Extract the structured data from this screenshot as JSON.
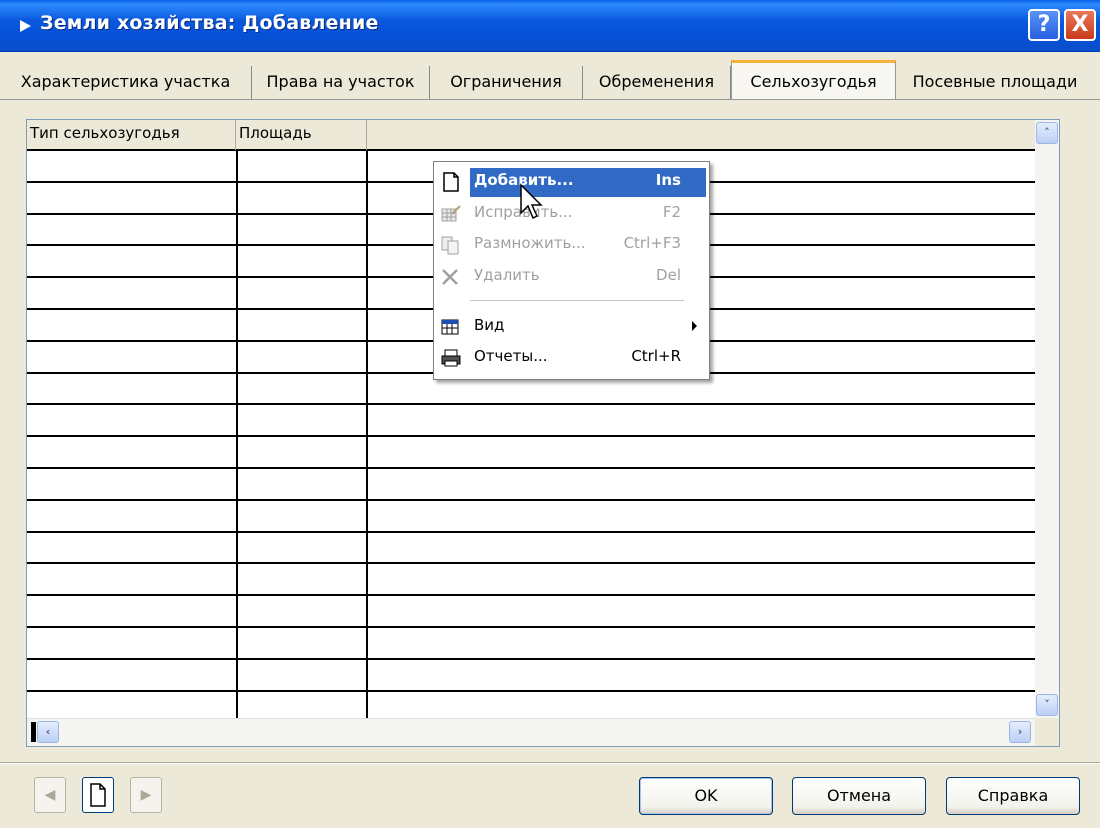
{
  "window": {
    "title": "Земли хозяйства: Добавление"
  },
  "title_buttons": {
    "help": "?",
    "close": "X"
  },
  "tabs": [
    {
      "label": "Характеристика участка",
      "active": false
    },
    {
      "label": "Права на участок",
      "active": false
    },
    {
      "label": "Ограничения",
      "active": false
    },
    {
      "label": "Обременения",
      "active": false
    },
    {
      "label": "Сельхозугодья",
      "active": true
    },
    {
      "label": "Посевные площади",
      "active": false
    }
  ],
  "table": {
    "columns": [
      "Тип сельхозугодья",
      "Площадь"
    ],
    "rows": []
  },
  "context_menu": {
    "items": [
      {
        "label": "Добавить...",
        "shortcut": "Ins",
        "icon": "new-document-icon",
        "state": "selected"
      },
      {
        "label": "Исправить...",
        "shortcut": "F2",
        "icon": "edit-table-icon",
        "state": "disabled"
      },
      {
        "label": "Размножить...",
        "shortcut": "Ctrl+F3",
        "icon": "copy-icon",
        "state": "disabled"
      },
      {
        "label": "Удалить",
        "shortcut": "Del",
        "icon": "delete-x-icon",
        "state": "disabled"
      },
      {
        "label": "Вид",
        "shortcut": "",
        "icon": "view-icon",
        "state": "normal",
        "submenu": true
      },
      {
        "label": "Отчеты...",
        "shortcut": "Ctrl+R",
        "icon": "printer-icon",
        "state": "normal"
      }
    ]
  },
  "scroll": {
    "left": "‹",
    "right": "›",
    "up": "˄",
    "down": "˅"
  },
  "nav": {
    "prev": "◀",
    "next": "▶"
  },
  "buttons": {
    "ok": "OK",
    "cancel": "Отмена",
    "help": "Справка"
  },
  "colors": {
    "title_bar": "#0A58DE",
    "selection": "#316AC5",
    "tab_accent": "#F8B13C",
    "dialog_bg": "#ECE9D8"
  }
}
